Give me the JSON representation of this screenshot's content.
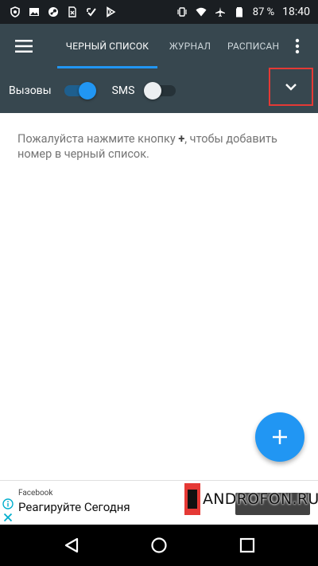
{
  "status_bar": {
    "battery_percent": "87 %",
    "time": "18:40",
    "icons_left": [
      "shield-icon",
      "image-icon",
      "steam-icon",
      "file-x-icon",
      "check-icon",
      "play-store-icon"
    ],
    "icons_right": [
      "vibrate-icon",
      "wifi-icon",
      "airplane-icon",
      "battery-icon"
    ]
  },
  "appbar": {
    "menu_icon": "hamburger-menu-icon",
    "tabs": [
      {
        "label": "ЧЕРНЫЙ СПИСОК",
        "active": true
      },
      {
        "label": "ЖУРНАЛ",
        "active": false
      },
      {
        "label": "РАСПИСАН",
        "active": false
      }
    ],
    "overflow_icon": "more-vertical-icon"
  },
  "filters": {
    "calls": {
      "label": "Вызовы",
      "enabled": true
    },
    "sms": {
      "label": "SMS",
      "enabled": false
    },
    "expand_icon": "chevron-down-icon"
  },
  "content": {
    "empty_before": "Пожалуйста нажмите кнопку ",
    "empty_plus": "+",
    "empty_after": ", чтобы добавить номер в черный список."
  },
  "fab": {
    "icon": "plus-icon"
  },
  "ad": {
    "advertiser": "Facebook",
    "headline": "Реагируйте Сегодня",
    "watermark": "ANDROFON.RU"
  },
  "navbar": {
    "buttons": [
      "back-icon",
      "home-icon",
      "recents-icon"
    ]
  },
  "colors": {
    "appbar": "#37474f",
    "accent": "#2196f3",
    "highlight_box": "#e53935"
  }
}
